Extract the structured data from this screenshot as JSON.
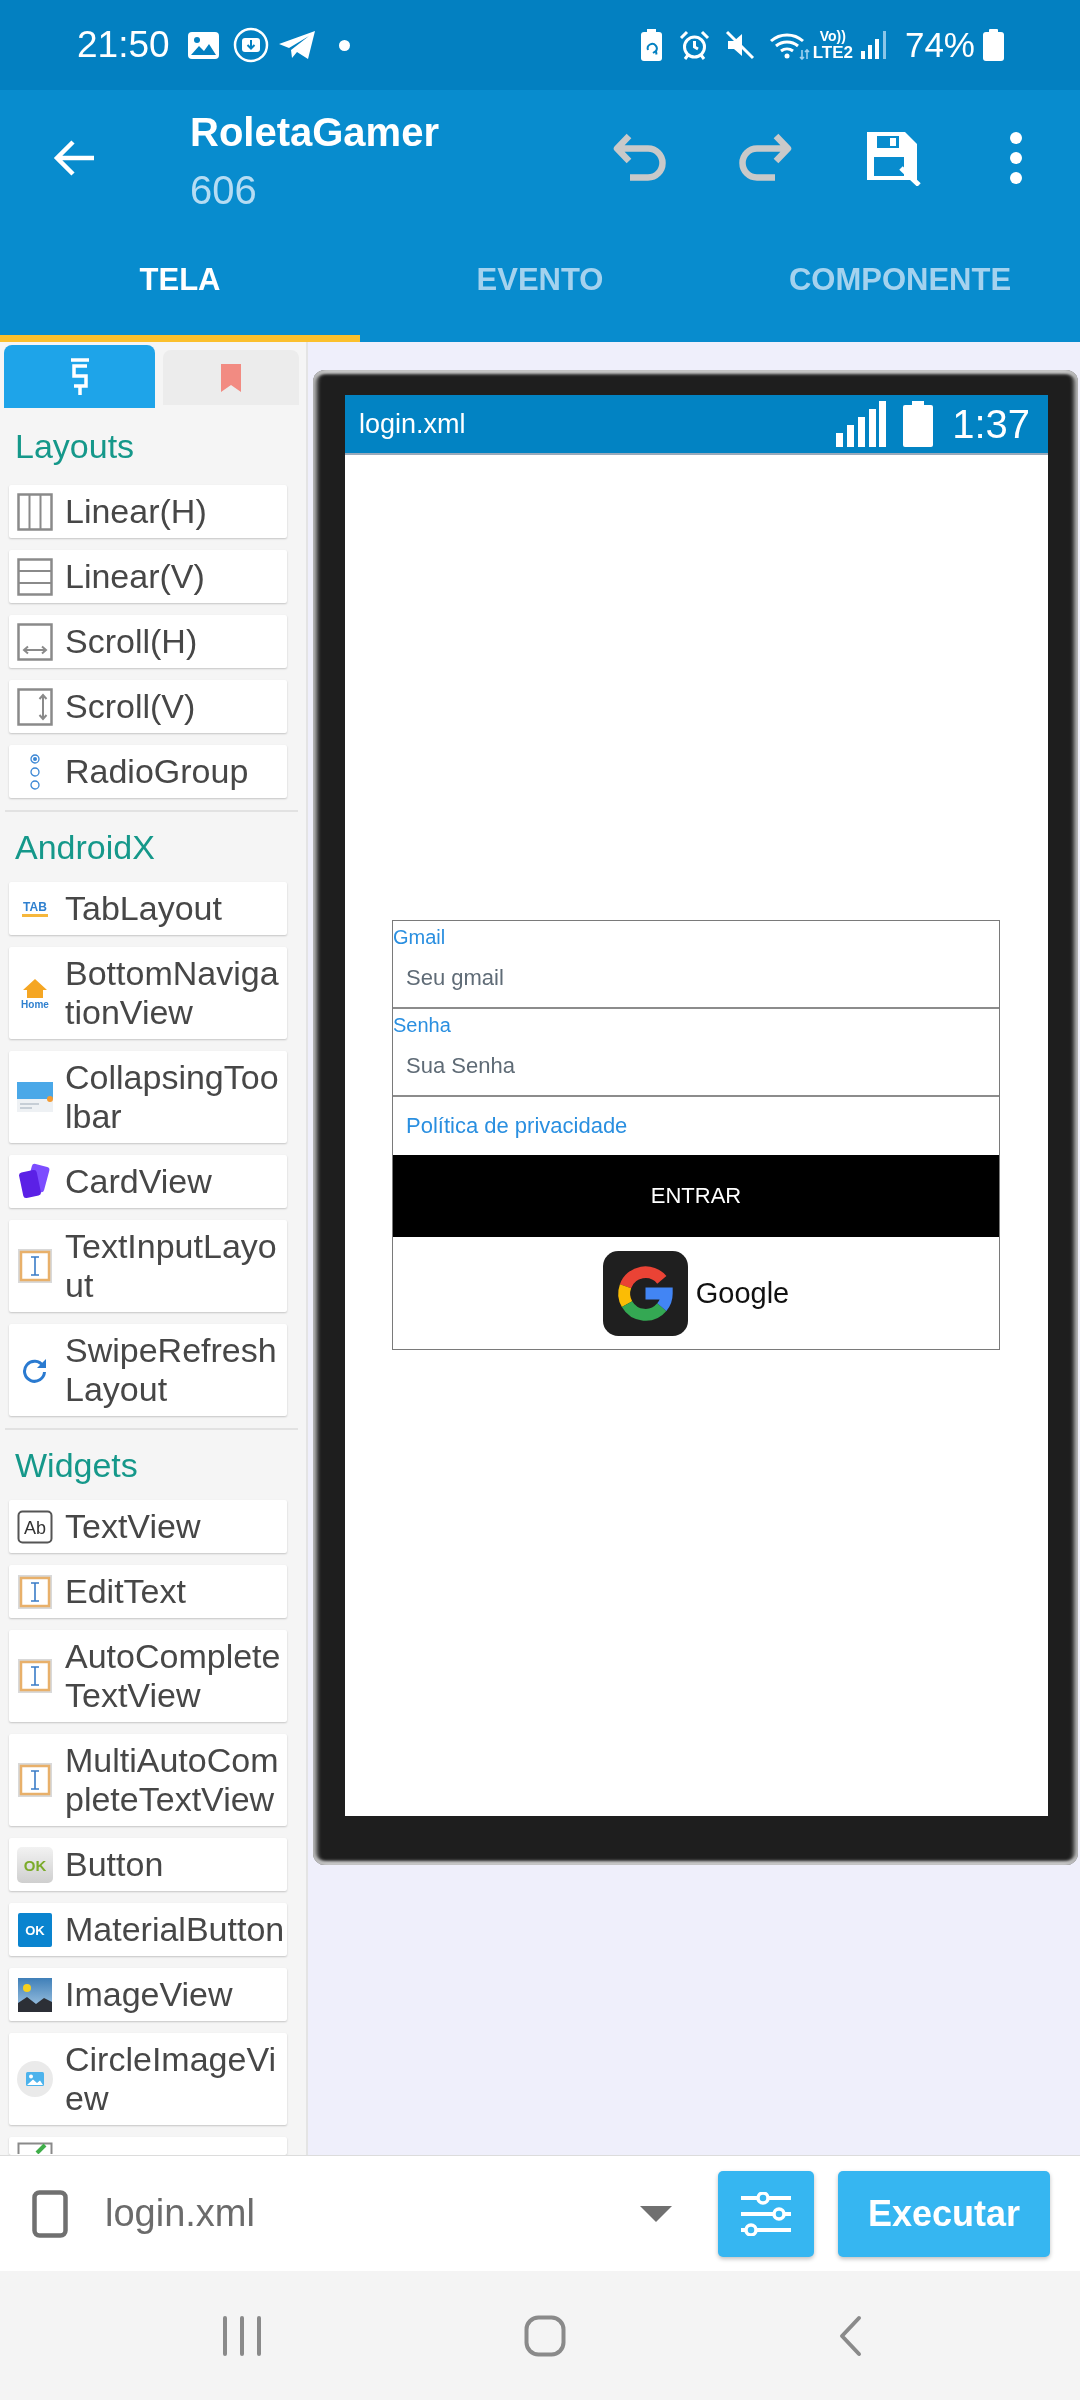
{
  "status_bar": {
    "time": "21:50",
    "volte": "Vo))",
    "network": "LTE2",
    "battery": "74%"
  },
  "app_bar": {
    "title": "RoletaGamer",
    "subtitle": "606",
    "actions": [
      {
        "kind": "undo",
        "disabled": true
      },
      {
        "kind": "redo",
        "disabled": true
      },
      {
        "kind": "save",
        "disabled": false
      },
      {
        "kind": "more",
        "disabled": false
      }
    ]
  },
  "tabs": [
    {
      "label": "TELA",
      "selected": true
    },
    {
      "label": "EVENTO",
      "selected": false
    },
    {
      "label": "COMPONENTE",
      "selected": false
    }
  ],
  "palette": {
    "tabs": [
      {
        "kind": "widgets",
        "selected": true
      },
      {
        "kind": "bookmarks",
        "selected": false
      }
    ],
    "sections": [
      {
        "title": "Layouts",
        "items": [
          {
            "label": "Linear(H)",
            "kind": "columns"
          },
          {
            "label": "Linear(V)",
            "kind": "rows"
          },
          {
            "label": "Scroll(H)",
            "kind": "hscroll"
          },
          {
            "label": "Scroll(V)",
            "kind": "vscroll"
          },
          {
            "label": "RadioGroup",
            "kind": "radio"
          }
        ]
      },
      {
        "title": "AndroidX",
        "items": [
          {
            "label": "TabLayout",
            "kind": "tabs",
            "icon_text": "TAB"
          },
          {
            "label": "BottomNavigationView",
            "kind": "bottomnav",
            "icon_text": "Home"
          },
          {
            "label": "CollapsingToolbar",
            "kind": "toolbar"
          },
          {
            "label": "CardView",
            "kind": "card"
          },
          {
            "label": "TextInputLayout",
            "kind": "edittext"
          },
          {
            "label": "SwipeRefreshLayout",
            "kind": "refresh"
          }
        ]
      },
      {
        "title": "Widgets",
        "items": [
          {
            "label": "TextView",
            "kind": "textview",
            "icon_text": "Ab"
          },
          {
            "label": "EditText",
            "kind": "edittext"
          },
          {
            "label": "AutoCompleteTextView",
            "kind": "edittext"
          },
          {
            "label": "MultiAutoCompleteTextView",
            "kind": "edittext"
          },
          {
            "label": "Button",
            "kind": "button",
            "icon_text": "OK"
          },
          {
            "label": "MaterialButton",
            "kind": "materialbutton",
            "icon_text": "OK"
          },
          {
            "label": "ImageView",
            "kind": "image"
          },
          {
            "label": "CircleImageView",
            "kind": "circleimage"
          },
          {
            "kind": "checkbox"
          }
        ]
      }
    ]
  },
  "preview": {
    "status_bar": {
      "title": "login.xml",
      "time": "1:37"
    },
    "fields": [
      {
        "label": "Gmail",
        "placeholder": "Seu gmail"
      },
      {
        "label": "Senha",
        "placeholder": "Sua Senha"
      }
    ],
    "link": "Política de privacidade",
    "login_button": "ENTRAR",
    "google_button": "Google"
  },
  "bottom_bar": {
    "file": "login.xml",
    "run_button": "Executar"
  }
}
